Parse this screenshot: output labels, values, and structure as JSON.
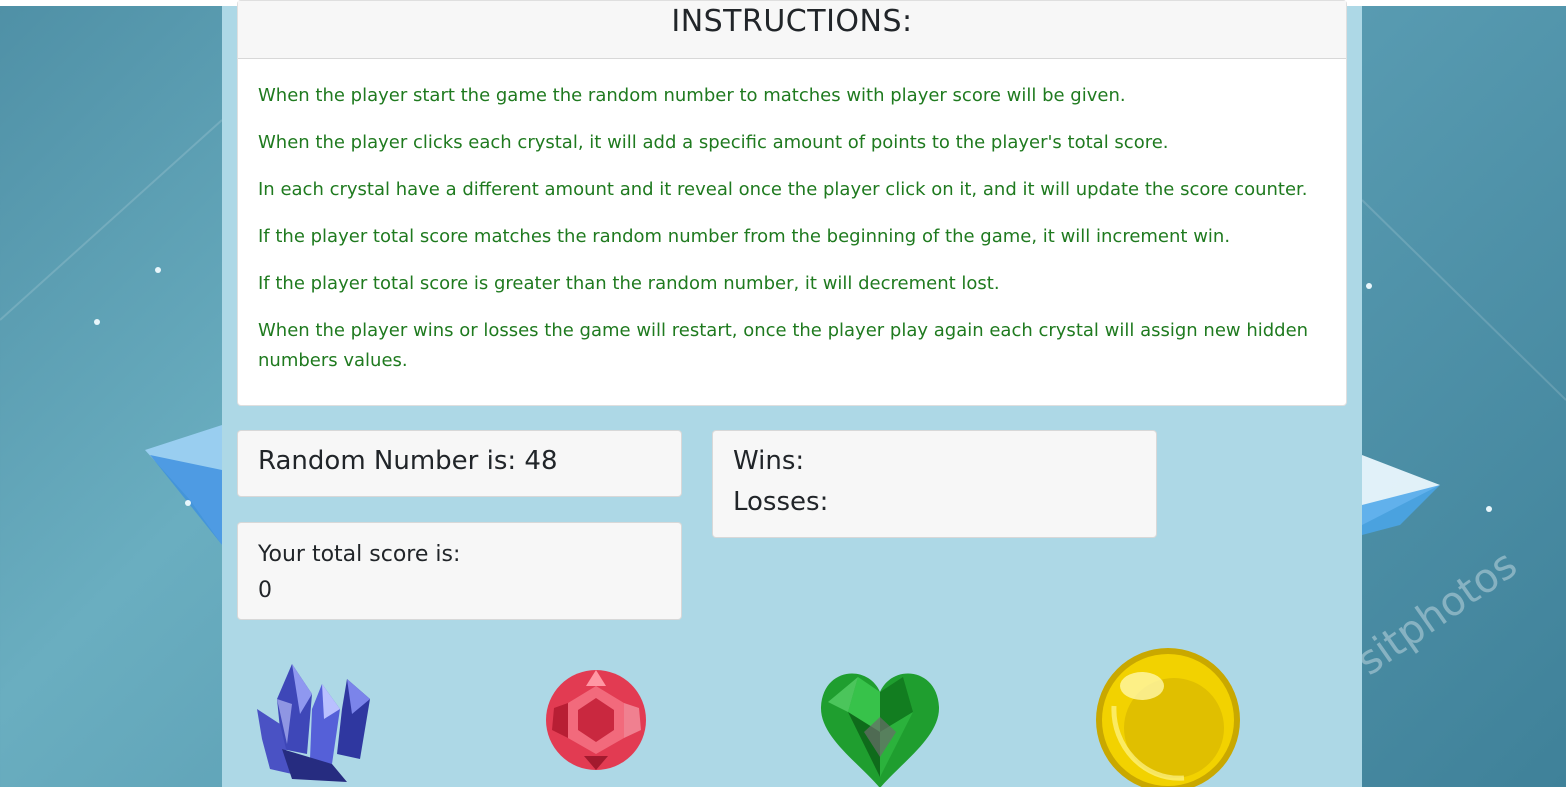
{
  "instructions": {
    "title": "INSTRUCTIONS:",
    "paragraphs": [
      "When the player start the game the random number to matches with player score will be given.",
      "When the player clicks each crystal, it will add a specific amount of points to the player's total score.",
      "In each crystal have a different amount and it reveal once the player click on it, and it will update the score counter.",
      "If the player total score matches the random number from the beginning of the game, it will increment win.",
      "If the player total score is greater than the random number, it will decrement lost.",
      "When the player wins or losses the game will restart, once the player play again each crystal will assign new hidden numbers values."
    ]
  },
  "random_number": {
    "label": "Random Number is: 48"
  },
  "record": {
    "wins_label": "Wins:",
    "losses_label": "Losses:"
  },
  "score": {
    "label": "Your total score is:",
    "value": "0"
  },
  "crystals": [
    {
      "icon": "blue-crystal-cluster-icon",
      "color": "#4b55c8"
    },
    {
      "icon": "red-round-gem-icon",
      "color": "#e23b52"
    },
    {
      "icon": "green-heart-gem-icon",
      "color": "#1f9e2f"
    },
    {
      "icon": "yellow-sphere-gem-icon",
      "color": "#f2d200"
    }
  ],
  "colors": {
    "container_bg": "#add8e6",
    "instruction_text": "#1f7a1f",
    "card_header_bg": "#f7f7f7"
  },
  "background": {
    "watermark": "sitphotos"
  }
}
